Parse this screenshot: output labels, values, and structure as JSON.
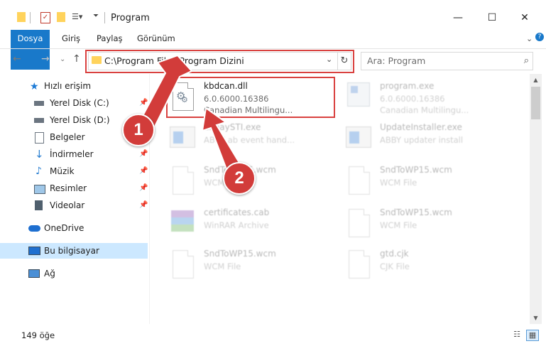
{
  "window": {
    "title": "Program",
    "controls": {
      "minimize": "—",
      "maximize": "☐",
      "close": "✕"
    }
  },
  "ribbon": {
    "tabs": [
      "Dosya",
      "Giriş",
      "Paylaş",
      "Görünüm"
    ]
  },
  "address_bar": {
    "path": "C:\\Program Files\\Program Dizini",
    "search_placeholder": "Ara: Program"
  },
  "sidebar": {
    "items": [
      {
        "label": "Hızlı erişim",
        "icon": "star-icon",
        "pinned": false
      },
      {
        "label": "Yerel Disk (C:)",
        "icon": "drive-icon",
        "pinned": true
      },
      {
        "label": "Yerel Disk (D:)",
        "icon": "drive-icon",
        "pinned": true
      },
      {
        "label": "Belgeler",
        "icon": "documents-icon",
        "pinned": true
      },
      {
        "label": "İndirmeler",
        "icon": "download-icon",
        "pinned": true
      },
      {
        "label": "Müzik",
        "icon": "music-icon",
        "pinned": true
      },
      {
        "label": "Resimler",
        "icon": "pictures-icon",
        "pinned": true
      },
      {
        "label": "Videolar",
        "icon": "videos-icon",
        "pinned": true
      },
      {
        "label": "OneDrive",
        "icon": "cloud-icon",
        "pinned": false
      },
      {
        "label": "Bu bilgisayar",
        "icon": "computer-icon",
        "pinned": false,
        "selected": true
      },
      {
        "label": "Ağ",
        "icon": "network-icon",
        "pinned": false
      }
    ]
  },
  "files": [
    {
      "name": "kbdcan.dll",
      "line2": "6.0.6000.16386",
      "line3": "Canadian Multilingu...",
      "icon": "dll-gear-icon"
    },
    {
      "name": "program.exe",
      "line2": "6.0.6000.16386",
      "line3": "Canadian Multilingu...",
      "icon": "exe-icon"
    },
    {
      "name": "ExpaySTI.exe",
      "line2": "ABBY ab event hand...",
      "line3": "",
      "icon": "app-window-icon"
    },
    {
      "name": "UpdateInstaller.exe",
      "line2": "ABBY updater install",
      "line3": "",
      "icon": "app-window-icon"
    },
    {
      "name": "SndToWP15.wcm",
      "line2": "WCM File",
      "line3": "",
      "icon": "document-icon"
    },
    {
      "name": "SndToWP15.wcm",
      "line2": "WCM File",
      "line3": "",
      "icon": "document-icon"
    },
    {
      "name": "certificates.cab",
      "line2": "WinRAR Archive",
      "line3": "",
      "icon": "winrar-icon"
    },
    {
      "name": "SndToWP15.wcm",
      "line2": "WCM File",
      "line3": "",
      "icon": "document-icon"
    },
    {
      "name": "SndToWP15.wcm",
      "line2": "WCM File",
      "line3": "",
      "icon": "document-icon"
    },
    {
      "name": "gtd.cjk",
      "line2": "CJK File",
      "line3": "",
      "icon": "document-icon"
    }
  ],
  "status": {
    "count": "149 öğe"
  },
  "annotations": {
    "step1": "1",
    "step2": "2"
  },
  "colors": {
    "accent": "#1979ca",
    "highlight": "#d9413f",
    "badge": "#d23c3a",
    "selected": "#cce8ff"
  }
}
